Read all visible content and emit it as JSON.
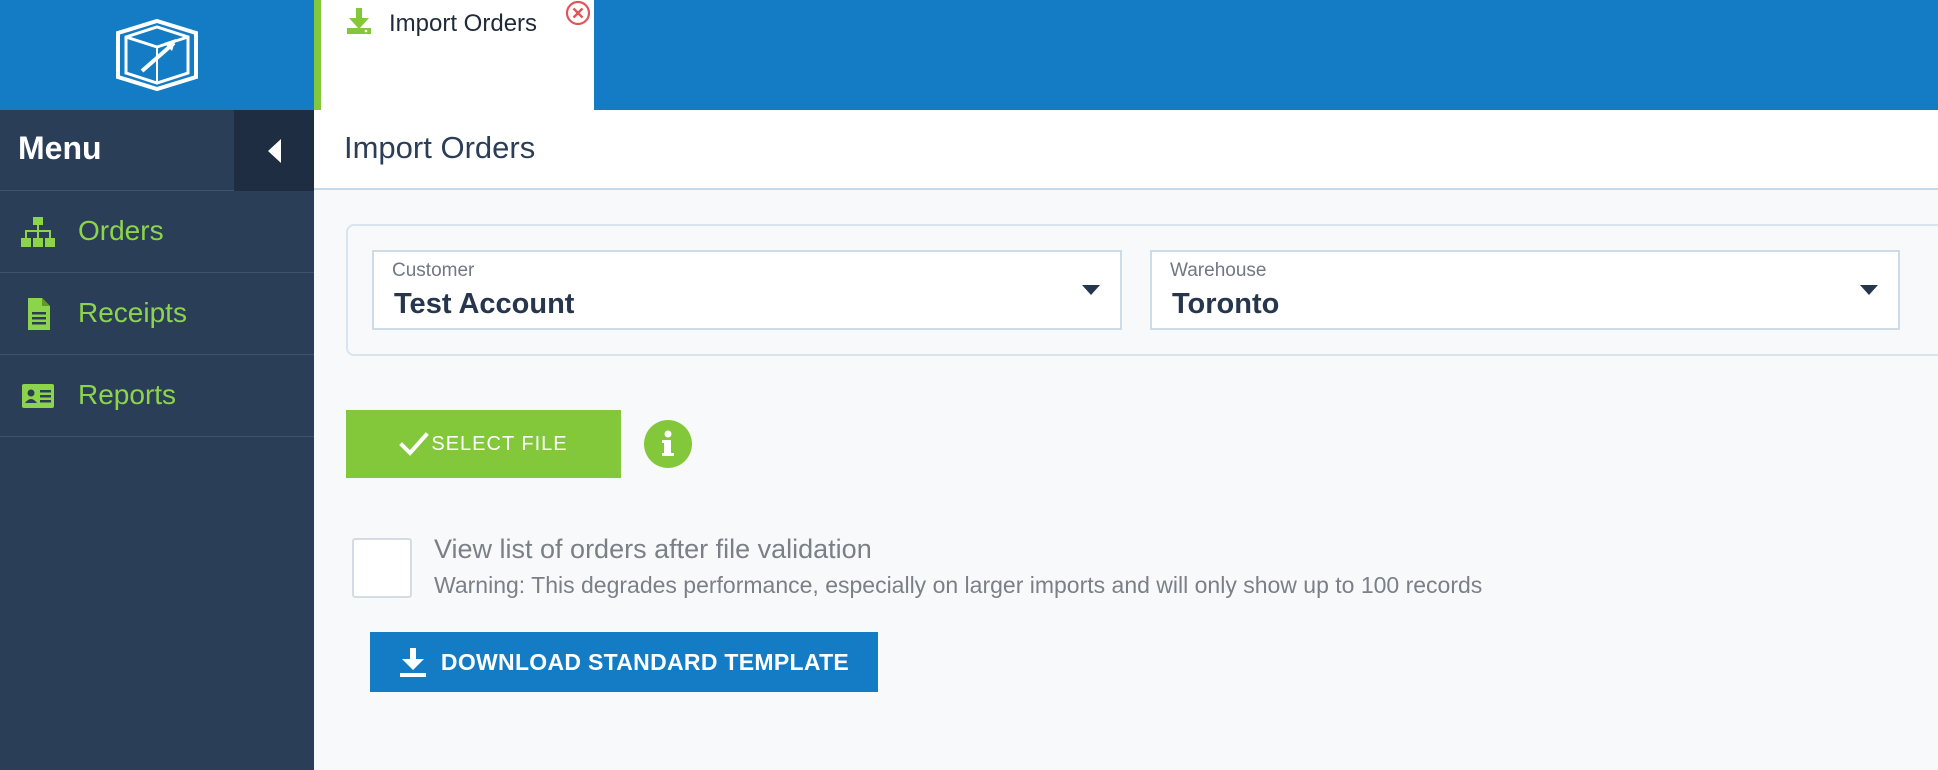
{
  "tab": {
    "label": "Import Orders",
    "icon": "download-icon",
    "close_icon": "close-circle-icon"
  },
  "sidebar": {
    "title": "Menu",
    "items": [
      {
        "label": "Orders",
        "icon": "sitemap-icon"
      },
      {
        "label": "Receipts",
        "icon": "document-icon"
      },
      {
        "label": "Reports",
        "icon": "id-card-icon"
      }
    ]
  },
  "page": {
    "title": "Import Orders"
  },
  "filters": {
    "customer": {
      "label": "Customer",
      "value": "Test Account"
    },
    "warehouse": {
      "label": "Warehouse",
      "value": "Toronto"
    }
  },
  "actions": {
    "select_file_label": "SELECT FILE",
    "download_template_label": "DOWNLOAD STANDARD TEMPLATE"
  },
  "validation_option": {
    "title": "View list of orders after file validation",
    "warning": "Warning: This degrades performance, especially on larger imports and will only show up to 100 records",
    "checked": false
  },
  "colors": {
    "brand_blue": "#147cc4",
    "accent_green": "#82c83a",
    "sidebar_bg": "#2b3e58",
    "nav_text": "#8cd54a",
    "close_red": "#e05555"
  }
}
